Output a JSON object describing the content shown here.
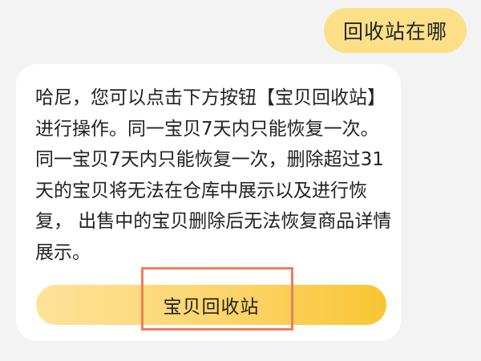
{
  "chat": {
    "user_message": "回收站在哪",
    "bot_message": "哈尼，您可以点击下方按钮【宝贝回收站】进行操作。同一宝贝7天内只能恢复一次。同一宝贝7天内只能恢复一次，删除超过31天的宝贝将无法在仓库中展示以及进行恢复， 出售中的宝贝删除后无法恢复商品详情展示。",
    "action_button_label": "宝贝回收站"
  },
  "colors": {
    "user_bubble": "#fbe087",
    "button_gradient_start": "#fde29a",
    "button_gradient_end": "#f8c534",
    "highlight_border": "#ee7d5a",
    "background": "#f3f3f3"
  }
}
